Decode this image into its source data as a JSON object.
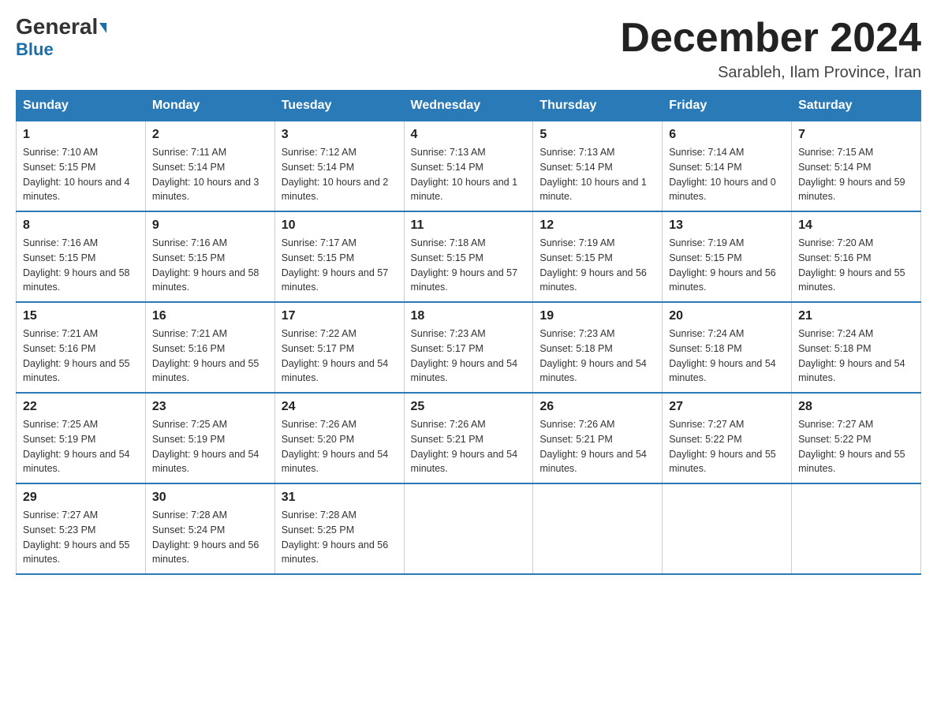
{
  "logo": {
    "general": "General",
    "arrow": "▶",
    "blue": "Blue"
  },
  "header": {
    "month": "December 2024",
    "location": "Sarableh, Ilam Province, Iran"
  },
  "weekdays": [
    "Sunday",
    "Monday",
    "Tuesday",
    "Wednesday",
    "Thursday",
    "Friday",
    "Saturday"
  ],
  "weeks": [
    [
      {
        "day": "1",
        "sunrise": "7:10 AM",
        "sunset": "5:15 PM",
        "daylight": "10 hours and 4 minutes."
      },
      {
        "day": "2",
        "sunrise": "7:11 AM",
        "sunset": "5:14 PM",
        "daylight": "10 hours and 3 minutes."
      },
      {
        "day": "3",
        "sunrise": "7:12 AM",
        "sunset": "5:14 PM",
        "daylight": "10 hours and 2 minutes."
      },
      {
        "day": "4",
        "sunrise": "7:13 AM",
        "sunset": "5:14 PM",
        "daylight": "10 hours and 1 minute."
      },
      {
        "day": "5",
        "sunrise": "7:13 AM",
        "sunset": "5:14 PM",
        "daylight": "10 hours and 1 minute."
      },
      {
        "day": "6",
        "sunrise": "7:14 AM",
        "sunset": "5:14 PM",
        "daylight": "10 hours and 0 minutes."
      },
      {
        "day": "7",
        "sunrise": "7:15 AM",
        "sunset": "5:14 PM",
        "daylight": "9 hours and 59 minutes."
      }
    ],
    [
      {
        "day": "8",
        "sunrise": "7:16 AM",
        "sunset": "5:15 PM",
        "daylight": "9 hours and 58 minutes."
      },
      {
        "day": "9",
        "sunrise": "7:16 AM",
        "sunset": "5:15 PM",
        "daylight": "9 hours and 58 minutes."
      },
      {
        "day": "10",
        "sunrise": "7:17 AM",
        "sunset": "5:15 PM",
        "daylight": "9 hours and 57 minutes."
      },
      {
        "day": "11",
        "sunrise": "7:18 AM",
        "sunset": "5:15 PM",
        "daylight": "9 hours and 57 minutes."
      },
      {
        "day": "12",
        "sunrise": "7:19 AM",
        "sunset": "5:15 PM",
        "daylight": "9 hours and 56 minutes."
      },
      {
        "day": "13",
        "sunrise": "7:19 AM",
        "sunset": "5:15 PM",
        "daylight": "9 hours and 56 minutes."
      },
      {
        "day": "14",
        "sunrise": "7:20 AM",
        "sunset": "5:16 PM",
        "daylight": "9 hours and 55 minutes."
      }
    ],
    [
      {
        "day": "15",
        "sunrise": "7:21 AM",
        "sunset": "5:16 PM",
        "daylight": "9 hours and 55 minutes."
      },
      {
        "day": "16",
        "sunrise": "7:21 AM",
        "sunset": "5:16 PM",
        "daylight": "9 hours and 55 minutes."
      },
      {
        "day": "17",
        "sunrise": "7:22 AM",
        "sunset": "5:17 PM",
        "daylight": "9 hours and 54 minutes."
      },
      {
        "day": "18",
        "sunrise": "7:23 AM",
        "sunset": "5:17 PM",
        "daylight": "9 hours and 54 minutes."
      },
      {
        "day": "19",
        "sunrise": "7:23 AM",
        "sunset": "5:18 PM",
        "daylight": "9 hours and 54 minutes."
      },
      {
        "day": "20",
        "sunrise": "7:24 AM",
        "sunset": "5:18 PM",
        "daylight": "9 hours and 54 minutes."
      },
      {
        "day": "21",
        "sunrise": "7:24 AM",
        "sunset": "5:18 PM",
        "daylight": "9 hours and 54 minutes."
      }
    ],
    [
      {
        "day": "22",
        "sunrise": "7:25 AM",
        "sunset": "5:19 PM",
        "daylight": "9 hours and 54 minutes."
      },
      {
        "day": "23",
        "sunrise": "7:25 AM",
        "sunset": "5:19 PM",
        "daylight": "9 hours and 54 minutes."
      },
      {
        "day": "24",
        "sunrise": "7:26 AM",
        "sunset": "5:20 PM",
        "daylight": "9 hours and 54 minutes."
      },
      {
        "day": "25",
        "sunrise": "7:26 AM",
        "sunset": "5:21 PM",
        "daylight": "9 hours and 54 minutes."
      },
      {
        "day": "26",
        "sunrise": "7:26 AM",
        "sunset": "5:21 PM",
        "daylight": "9 hours and 54 minutes."
      },
      {
        "day": "27",
        "sunrise": "7:27 AM",
        "sunset": "5:22 PM",
        "daylight": "9 hours and 55 minutes."
      },
      {
        "day": "28",
        "sunrise": "7:27 AM",
        "sunset": "5:22 PM",
        "daylight": "9 hours and 55 minutes."
      }
    ],
    [
      {
        "day": "29",
        "sunrise": "7:27 AM",
        "sunset": "5:23 PM",
        "daylight": "9 hours and 55 minutes."
      },
      {
        "day": "30",
        "sunrise": "7:28 AM",
        "sunset": "5:24 PM",
        "daylight": "9 hours and 56 minutes."
      },
      {
        "day": "31",
        "sunrise": "7:28 AM",
        "sunset": "5:25 PM",
        "daylight": "9 hours and 56 minutes."
      },
      null,
      null,
      null,
      null
    ]
  ]
}
